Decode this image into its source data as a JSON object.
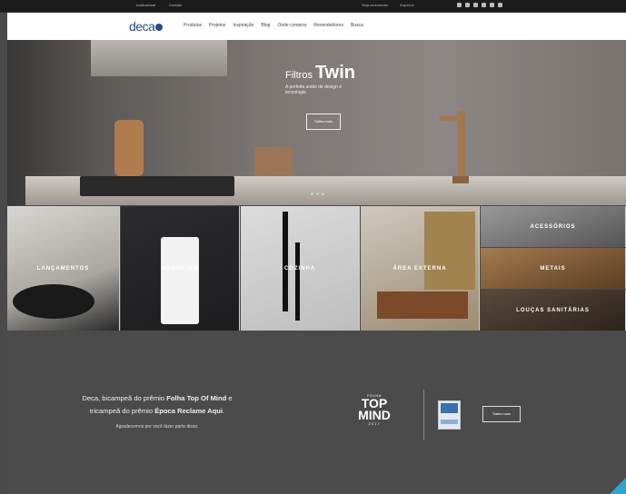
{
  "topbar": {
    "left_links": [
      "Institucional",
      "Contato"
    ],
    "right_links": [
      "Seja revendedor",
      "Arquivos"
    ],
    "social_icons": [
      "facebook-icon",
      "twitter-icon",
      "instagram-icon",
      "youtube-icon",
      "pinterest-icon",
      "linkedin-icon"
    ]
  },
  "nav": {
    "logo_text": "deca",
    "items": [
      "Produtos",
      "Projetos",
      "Inspiração",
      "Blog",
      "Onde comprar",
      "Revendedores",
      "Busca"
    ]
  },
  "hero": {
    "title_pre": "Filtros",
    "title_main": "Twin",
    "subtitle": "A perfeita união de design e tecnologia",
    "button": "Saiba mais",
    "slider_dots": 3
  },
  "categories": [
    {
      "label": "LANÇAMENTOS"
    },
    {
      "label": "BANHEIRO"
    },
    {
      "label": "COZINHA"
    },
    {
      "label": "ÁREA EXTERNA"
    },
    {
      "label": "ACESSÓRIOS"
    },
    {
      "label": "METAIS"
    },
    {
      "label": "LOUÇAS SANITÁRIAS"
    }
  ],
  "awards": {
    "line1_a": "Deca, bicampeã do prêmio ",
    "line1_b": "Folha Top Of Mind",
    "line1_c": " e",
    "line2_a": "tricampeã do prêmio ",
    "line2_b": "Época Reclame Aqui",
    "line2_c": ".",
    "line3": "Agradecemos por você fazer parte disso.",
    "topmind_label": "FOLHA",
    "topmind_title_1": "TOP",
    "topmind_title_2": "MIND",
    "topmind_year": "2017",
    "button": "Saiba mais"
  },
  "colors": {
    "accent": "#2fa3d3",
    "brand": "#2a4a8a",
    "band": "#4b4b4b"
  }
}
